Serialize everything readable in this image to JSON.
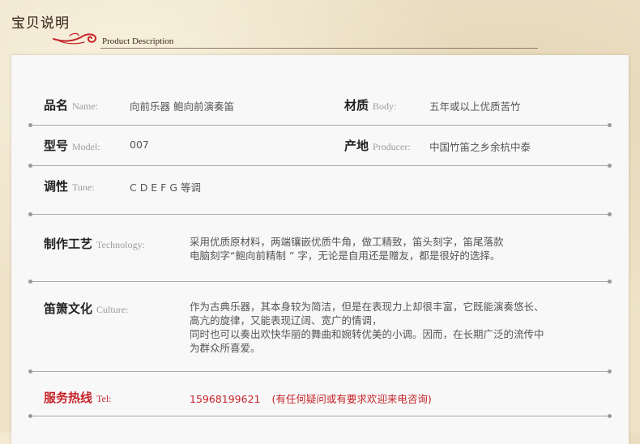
{
  "header": {
    "title": "宝贝说明",
    "subtitle": "Product Description"
  },
  "rows": {
    "name": {
      "label_cn": "品名",
      "label_en": "Name:",
      "value": "向前乐器  鲍向前演奏笛"
    },
    "body": {
      "label_cn": "材质",
      "label_en": "Body:",
      "value": "五年或以上优质苦竹"
    },
    "model": {
      "label_cn": "型号",
      "label_en": "Model:",
      "value": "007"
    },
    "producer": {
      "label_cn": "产地",
      "label_en": "Producer:",
      "value": "中国竹笛之乡余杭中泰"
    },
    "tune": {
      "label_cn": "调性",
      "label_en": "Tune:",
      "value": "C D E F G 等调"
    },
    "technology": {
      "label_cn": "制作工艺",
      "label_en": "Technology:",
      "lines": [
        "采用优质原材料，两端镶嵌优质牛角，做工精致，笛头刻字，笛尾落款",
        "电脑刻字“鲍向前精制 ” 字，无论是自用还是赠友，都是很好的选择。"
      ]
    },
    "culture": {
      "label_cn": "笛箫文化",
      "label_en": "Culture:",
      "lines": [
        "作为古典乐器，其本身较为简洁，但是在表现力上却很丰富，它既能演奏悠长、",
        "高亢的旋律，又能表现辽阔、宽广的情调，",
        "同时也可以奏出欢快华丽的舞曲和婉转优美的小调。因而，在长期广泛的流传中",
        "为群众所喜爱。"
      ]
    },
    "tel": {
      "label_cn": "服务热线",
      "label_en": "Tel:",
      "value": "15968199621",
      "note": "(有任何疑问或有要求欢迎来电咨询)"
    }
  },
  "colors": {
    "background": "#eee3c9",
    "panel": "#f8f8f8",
    "accent_red": "#c6232a",
    "label": "#222222",
    "label_en": "#9c9c9c",
    "value": "#555555"
  },
  "icons": {
    "header_ornament": "red-cloud-swirl-icon"
  }
}
